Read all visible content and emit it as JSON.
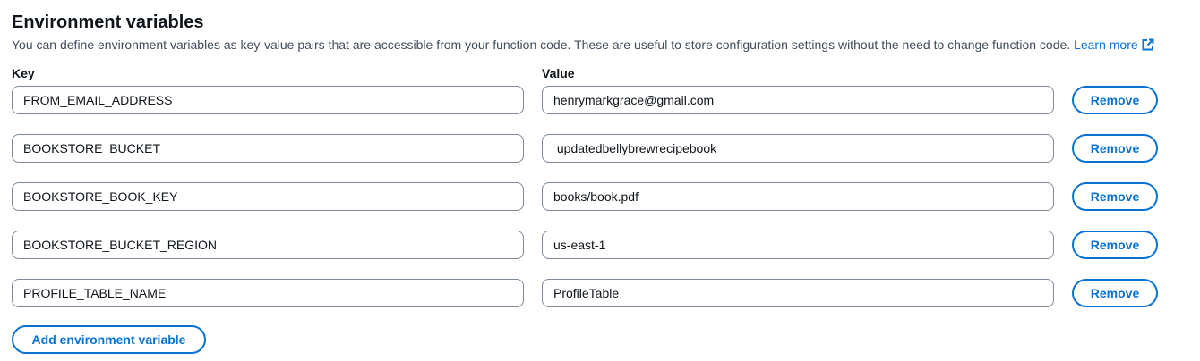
{
  "section": {
    "title": "Environment variables",
    "description": "You can define environment variables as key-value pairs that are accessible from your function code. These are useful to store configuration settings without the need to change function code.",
    "learn_more": "Learn more",
    "learn_more_icon": "external-link-icon",
    "accent_color": "#0972d3"
  },
  "columns": {
    "key": "Key",
    "value": "Value"
  },
  "variables": [
    {
      "key": "FROM_EMAIL_ADDRESS",
      "value": "henrymarkgrace@gmail.com",
      "remove_label": "Remove"
    },
    {
      "key": "BOOKSTORE_BUCKET",
      "value": " updatedbellybrewrecipebook",
      "remove_label": "Remove"
    },
    {
      "key": "BOOKSTORE_BOOK_KEY",
      "value": "books/book.pdf",
      "remove_label": "Remove"
    },
    {
      "key": "BOOKSTORE_BUCKET_REGION",
      "value": "us-east-1",
      "remove_label": "Remove"
    },
    {
      "key": "PROFILE_TABLE_NAME",
      "value": "ProfileTable",
      "remove_label": "Remove"
    }
  ],
  "add_button": "Add environment variable"
}
